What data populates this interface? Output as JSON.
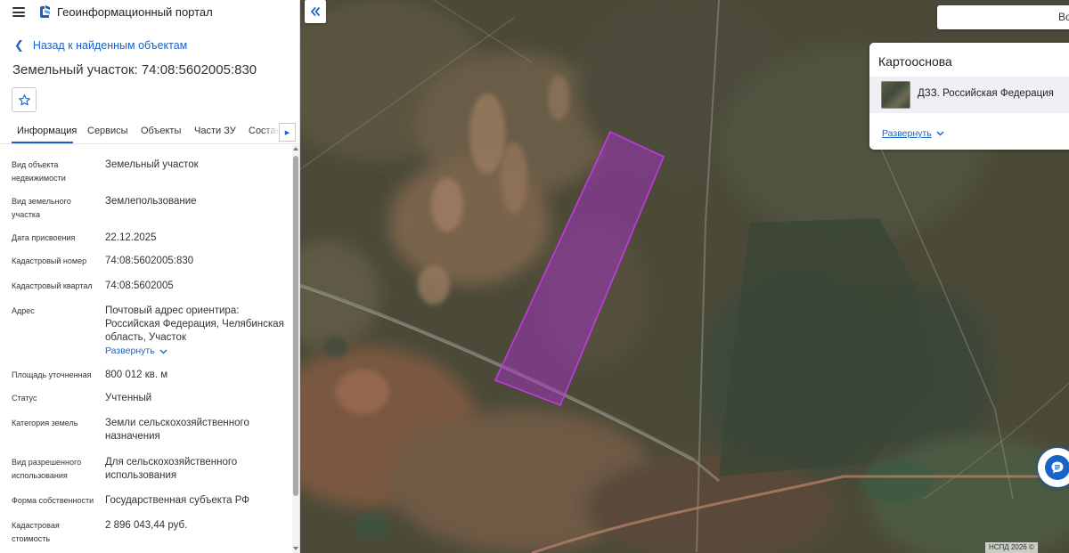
{
  "header": {
    "portal_title": "Геоинформационный портал",
    "menu_icon": "hamburger-icon",
    "logo_icon": "portal-logo-icon"
  },
  "navigation": {
    "back_label": "Назад к найденным объектам"
  },
  "object": {
    "title": "Земельный участок: 74:08:5602005:830"
  },
  "tabs": [
    {
      "label": "Информация",
      "active": true
    },
    {
      "label": "Сервисы",
      "active": false
    },
    {
      "label": "Объекты",
      "active": false
    },
    {
      "label": "Части ЗУ",
      "active": false
    },
    {
      "label": "Состав",
      "active": false
    }
  ],
  "properties": [
    {
      "label": "Вид объекта недвижимости",
      "value": "Земельный участок"
    },
    {
      "label": "Вид земельного участка",
      "value": "Землепользование"
    },
    {
      "label": "Дата присвоения",
      "value": "22.12.2025"
    },
    {
      "label": "Кадастровый номер",
      "value": "74:08:5602005:830"
    },
    {
      "label": "Кадастровый квартал",
      "value": "74:08:5602005"
    },
    {
      "label": "Адрес",
      "value": "Почтовый адрес ориентира: Российская Федерация, Челябинская область, Участок",
      "expand_label": "Развернуть"
    },
    {
      "label": "Площадь уточненная",
      "value": "800 012 кв. м"
    },
    {
      "label": "Статус",
      "value": "Учтенный"
    },
    {
      "label": "Категория земель",
      "value": "Земли сельскохозяйственного назначения"
    },
    {
      "label": "Вид разрешенного использования",
      "value": "Для сельскохозяйственного использования"
    },
    {
      "label": "Форма собственности",
      "value": "Государственная субъекта РФ"
    },
    {
      "label": "Кадастровая стоимость",
      "value": "2 896 043,44 руб."
    }
  ],
  "map": {
    "search_text": "Во",
    "basemap": {
      "title": "Картооснова",
      "layer_name": "ДЗЗ. Российская Федерация",
      "expand_label": "Развернуть"
    },
    "attribution": "НСПД 2026 ©",
    "parcel_color": "#b02fd6",
    "accent_color": "#1a63c6"
  }
}
